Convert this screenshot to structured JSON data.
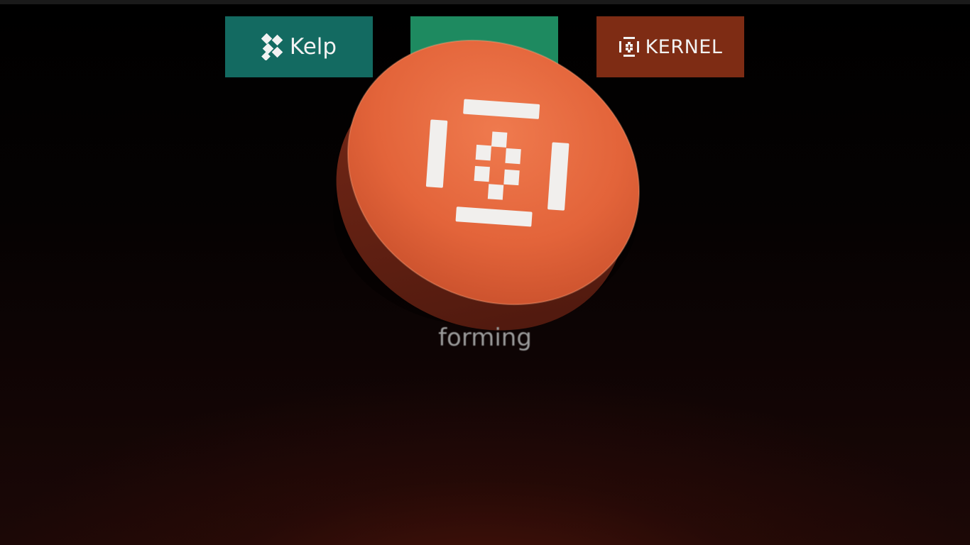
{
  "logos": {
    "kelp": {
      "label": "Kelp",
      "icon": "kelp-logo-icon",
      "color": "#136a61"
    },
    "middle": {
      "label": "",
      "icon": "",
      "color": "#1e8a60"
    },
    "kernel": {
      "label": "KERNEL",
      "icon": "kernel-logo-icon",
      "color": "#7e2c14"
    }
  },
  "coin": {
    "icon": "kernel-logo-icon",
    "color": "#e0653d"
  },
  "caption": "forming"
}
